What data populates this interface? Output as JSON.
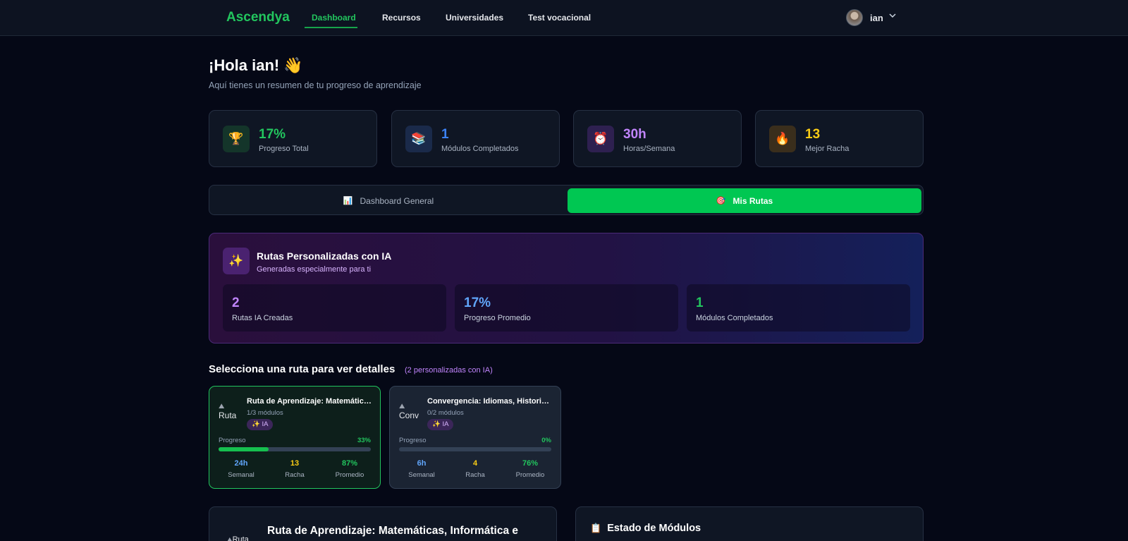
{
  "nav": {
    "brand": "Ascendya",
    "links": [
      {
        "label": "Dashboard",
        "active": true
      },
      {
        "label": "Recursos"
      },
      {
        "label": "Universidades"
      },
      {
        "label": "Test vocacional"
      }
    ],
    "user": "ian"
  },
  "header": {
    "greeting": "¡Hola ian!",
    "greeting_emoji": "👋",
    "subtitle": "Aquí tienes un resumen de tu progreso de aprendizaje"
  },
  "stats": [
    {
      "icon": "trophy-icon",
      "glyph": "🏆",
      "value": "17%",
      "label": "Progreso Total",
      "color": "#22c55e",
      "bg": "#14352a"
    },
    {
      "icon": "books-icon",
      "glyph": "📚",
      "value": "1",
      "label": "Módulos Completados",
      "color": "#3b82f6",
      "bg": "#1a2a4a"
    },
    {
      "icon": "clock-icon",
      "glyph": "⏰",
      "value": "30h",
      "label": "Horas/Semana",
      "color": "#c084fc",
      "bg": "#2e2050"
    },
    {
      "icon": "fire-icon",
      "glyph": "🔥",
      "value": "13",
      "label": "Mejor Racha",
      "color": "#facc15",
      "bg": "#3a2e1c"
    }
  ],
  "tabs": {
    "general": {
      "label": "Dashboard General",
      "glyph": "📊"
    },
    "rutas": {
      "label": "Mis Rutas",
      "glyph": "🎯"
    }
  },
  "ai_panel": {
    "glyph": "✨",
    "title": "Rutas Personalizadas con IA",
    "subtitle": "Generadas especialmente para ti",
    "stats": [
      {
        "value": "2",
        "label": "Rutas IA Creadas",
        "color": "#c084fc"
      },
      {
        "value": "17%",
        "label": "Progreso Promedio",
        "color": "#60a5fa"
      },
      {
        "value": "1",
        "label": "Módulos Completados",
        "color": "#22c55e"
      }
    ]
  },
  "select": {
    "title": "Selecciona una ruta para ver detalles",
    "note": "(2 personalizadas con IA)"
  },
  "routes": [
    {
      "thumb_alt": "Ruta",
      "title": "Ruta de Aprendizaje: Matemáticas, Informática e Ingeniería",
      "modules": "1/3 módulos",
      "badge": "✨ IA",
      "progress_label": "Progreso",
      "progress_pct": "33%",
      "progress_value": 0.33,
      "metrics": [
        {
          "value": "24h",
          "label": "Semanal",
          "color": "#60a5fa"
        },
        {
          "value": "13",
          "label": "Racha",
          "color": "#facc15"
        },
        {
          "value": "87%",
          "label": "Promedio",
          "color": "#22c55e"
        }
      ]
    },
    {
      "thumb_alt": "Conv",
      "title": "Convergencia: Idiomas, Historia, Arte",
      "modules": "0/2 módulos",
      "badge": "✨ IA",
      "progress_label": "Progreso",
      "progress_pct": "0%",
      "progress_value": 0,
      "metrics": [
        {
          "value": "6h",
          "label": "Semanal",
          "color": "#60a5fa"
        },
        {
          "value": "4",
          "label": "Racha",
          "color": "#facc15"
        },
        {
          "value": "76%",
          "label": "Promedio",
          "color": "#22c55e"
        }
      ]
    }
  ],
  "bottom": {
    "left_thumb": "Ruta",
    "left_title": "Ruta de Aprendizaje: Matemáticas, Informática e Ingeniería",
    "right_glyph": "📋",
    "right_title": "Estado de Módulos"
  }
}
